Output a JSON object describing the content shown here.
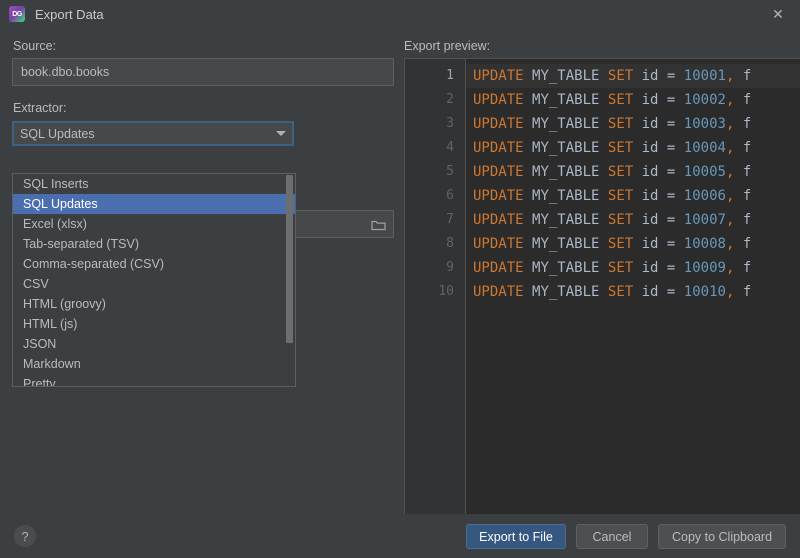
{
  "window": {
    "title": "Export Data",
    "app_icon": "datagrip-icon",
    "icon_text": "DG",
    "close_icon": "close-icon"
  },
  "left": {
    "source_label": "Source:",
    "source_value": "book.dbo.books",
    "extractor_label": "Extractor:",
    "extractor_value": "SQL Updates",
    "dropdown_arrow_icon": "chevron-down-icon",
    "browse_icon": "folder-icon",
    "options": [
      {
        "label": "SQL Inserts",
        "selected": false
      },
      {
        "label": "SQL Updates",
        "selected": true
      },
      {
        "label": "Excel (xlsx)",
        "selected": false
      },
      {
        "label": "Tab-separated (TSV)",
        "selected": false
      },
      {
        "label": "Comma-separated (CSV)",
        "selected": false
      },
      {
        "label": "CSV",
        "selected": false
      },
      {
        "label": "HTML (groovy)",
        "selected": false
      },
      {
        "label": "HTML (js)",
        "selected": false
      },
      {
        "label": "JSON",
        "selected": false
      },
      {
        "label": "Markdown",
        "selected": false
      },
      {
        "label": "Pretty",
        "selected": false
      }
    ]
  },
  "right": {
    "preview_label": "Export preview:",
    "lines": [
      {
        "number": "1",
        "id": "10001",
        "current": true
      },
      {
        "number": "2",
        "id": "10002",
        "current": false
      },
      {
        "number": "3",
        "id": "10003",
        "current": false
      },
      {
        "number": "4",
        "id": "10004",
        "current": false
      },
      {
        "number": "5",
        "id": "10005",
        "current": false
      },
      {
        "number": "6",
        "id": "10006",
        "current": false
      },
      {
        "number": "7",
        "id": "10007",
        "current": false
      },
      {
        "number": "8",
        "id": "10008",
        "current": false
      },
      {
        "number": "9",
        "id": "10009",
        "current": false
      },
      {
        "number": "10",
        "id": "10010",
        "current": false
      }
    ],
    "sql": {
      "keyword_update": "UPDATE",
      "table": "MY_TABLE",
      "keyword_set": "SET",
      "column": "id",
      "equals": "=",
      "comma": ",",
      "next_col_truncated": "f"
    }
  },
  "bottom": {
    "help_label": "?",
    "export_label": "Export to File",
    "cancel_label": "Cancel",
    "copy_label": "Copy to Clipboard"
  },
  "colors": {
    "dialog_bg": "#3C3F41",
    "field_bg": "#45494A",
    "editor_bg": "#2B2B2B",
    "gutter_bg": "#313335",
    "selection_blue": "#4B6EAF",
    "focus_border": "#3D6185",
    "default_button": "#365880",
    "keyword_orange": "#CC7832",
    "number_blue": "#6897BB",
    "text_gray": "#A9B7C6"
  }
}
